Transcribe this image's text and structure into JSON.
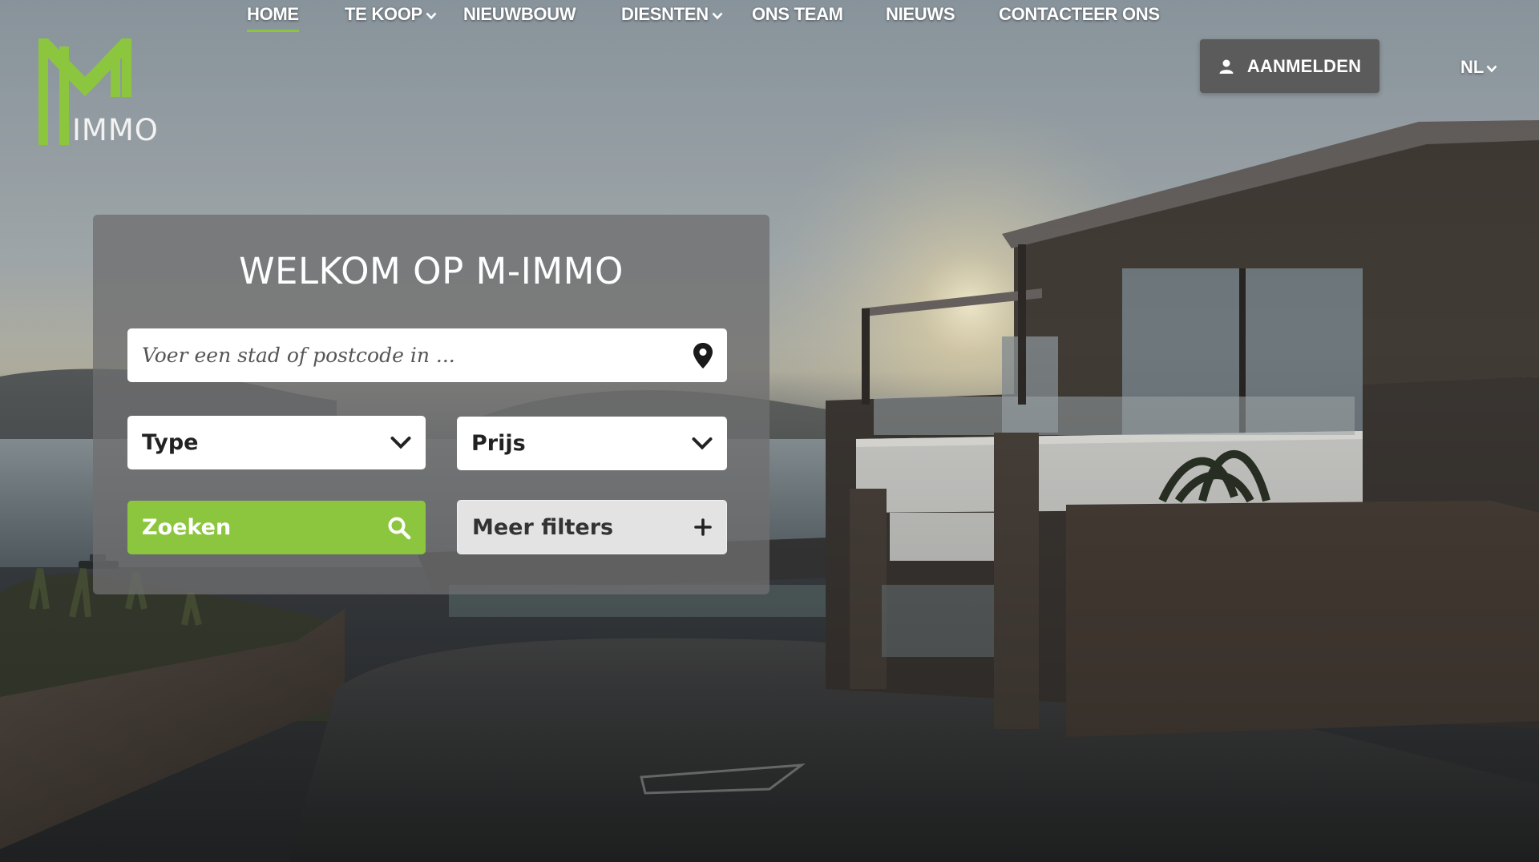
{
  "brand": {
    "logo_text": "IMMO",
    "primary_color": "#8cc63e",
    "logo_icon": "m-monogram-icon"
  },
  "nav": {
    "items": [
      {
        "label": "HOME",
        "active": true,
        "has_dropdown": false
      },
      {
        "label": "TE KOOP",
        "active": false,
        "has_dropdown": true
      },
      {
        "label": "NIEUWBOUW",
        "active": false,
        "has_dropdown": false
      },
      {
        "label": "DIESNTEN",
        "active": false,
        "has_dropdown": true
      },
      {
        "label": "ONS TEAM",
        "active": false,
        "has_dropdown": false
      },
      {
        "label": "NIEUWS",
        "active": false,
        "has_dropdown": false
      },
      {
        "label": "CONTACTEER ONS",
        "active": false,
        "has_dropdown": false
      }
    ],
    "login_label": "AANMELDEN",
    "login_icon": "user-icon",
    "language": "NL"
  },
  "search": {
    "title": "WELKOM OP M-IMMO",
    "location_placeholder": "Voer een stad of postcode in ...",
    "location_value": "",
    "location_icon": "map-pin-icon",
    "type_label": "Type",
    "price_label": "Prijs",
    "search_label": "Zoeken",
    "search_icon": "search-icon",
    "filters_label": "Meer filters",
    "filters_icon": "plus-icon",
    "search_button_color": "#8cc63e"
  }
}
